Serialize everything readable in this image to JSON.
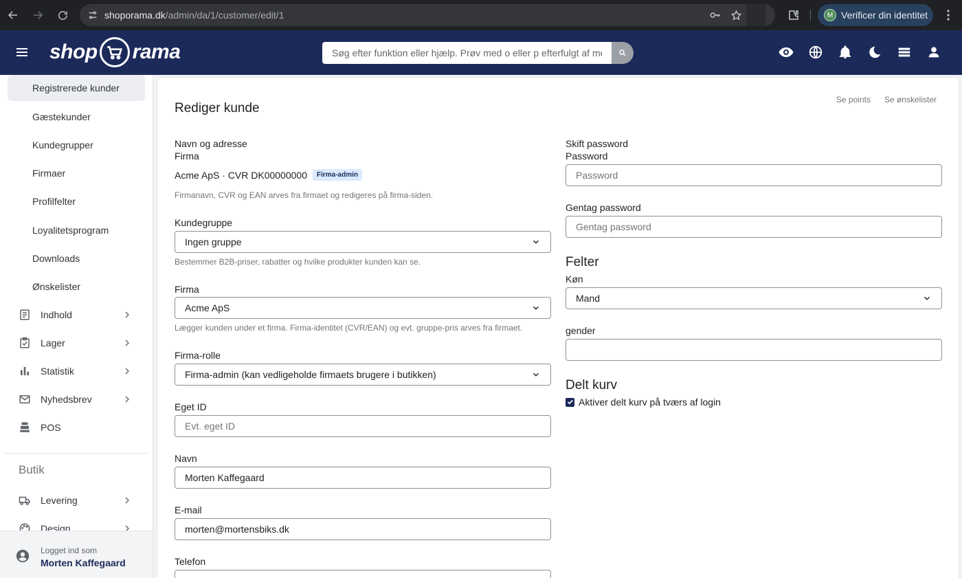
{
  "browser": {
    "url_host": "shoporama.dk",
    "url_path": "/admin/da/1/customer/edit/1",
    "verify_label": "Verificer din identitet",
    "profile_initial": "M"
  },
  "header": {
    "logo_left": "shop",
    "logo_right": "rama",
    "search_placeholder": "Søg efter funktion eller hjælp. Prøv med o eller p efterfulgt af mellemrum"
  },
  "sidebar": {
    "sub_items": [
      "Registrerede kunder",
      "Gæstekunder",
      "Kundegrupper",
      "Firmaer",
      "Profilfelter",
      "Loyalitetsprogram",
      "Downloads",
      "Ønskelister"
    ],
    "main_items": [
      {
        "label": "Indhold",
        "icon": "document-icon"
      },
      {
        "label": "Lager",
        "icon": "clipboard-check-icon"
      },
      {
        "label": "Statistik",
        "icon": "bar-chart-icon"
      },
      {
        "label": "Nyhedsbrev",
        "icon": "mail-icon"
      },
      {
        "label": "POS",
        "icon": "register-icon"
      }
    ],
    "section_title": "Butik",
    "shop_items": [
      {
        "label": "Levering",
        "icon": "truck-icon"
      },
      {
        "label": "Design",
        "icon": "palette-icon"
      }
    ],
    "footer": {
      "label": "Logget ind som",
      "name": "Morten Kaffegaard"
    }
  },
  "page": {
    "title": "Rediger kunde",
    "links": [
      "Se points",
      "Se ønskelister"
    ],
    "left": {
      "section_title": "Navn og adresse",
      "firm_label": "Firma",
      "firm_text": "Acme ApS · CVR DK00000000",
      "firm_tag": "Firma-admin",
      "firm_help": "Firmanavn, CVR og EAN arves fra firmaet og redigeres på firma-siden.",
      "group_label": "Kundegruppe",
      "group_value": "Ingen gruppe",
      "group_help": "Bestemmer B2B-priser, rabatter og hvilke produkter kunden kan se.",
      "company_label": "Firma",
      "company_value": "Acme ApS",
      "company_help": "Lægger kunden under et firma. Firma-identitet (CVR/EAN) og evt. gruppe-pris arves fra firmaet.",
      "role_label": "Firma-rolle",
      "role_value": "Firma-admin (kan vedligeholde firmaets brugere i butikken)",
      "ownid_label": "Eget ID",
      "ownid_placeholder": "Evt. eget ID",
      "name_label": "Navn",
      "name_value": "Morten Kaffegaard",
      "email_label": "E-mail",
      "email_value": "morten@mortensbiks.dk",
      "phone_label": "Telefon"
    },
    "right": {
      "section_title": "Skift password",
      "password_label": "Password",
      "password_placeholder": "Password",
      "repeat_label": "Gentag password",
      "repeat_placeholder": "Gentag password",
      "fields_heading": "Felter",
      "gender_label": "Køn",
      "gender_value": "Mand",
      "gender2_label": "gender",
      "gender2_value": "",
      "shared_heading": "Delt kurv",
      "shared_check_label": "Aktiver delt kurv på tværs af login",
      "shared_checked": true
    }
  },
  "colors": {
    "navy": "#1c2a5a",
    "chrome": "#202124",
    "tag_bg": "#dbeafe"
  }
}
